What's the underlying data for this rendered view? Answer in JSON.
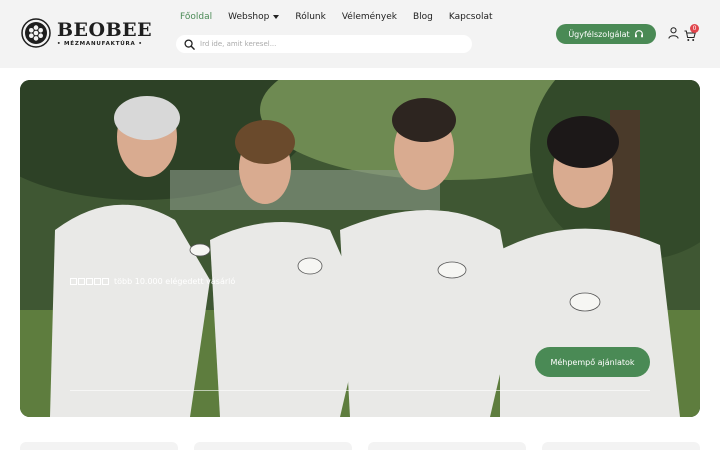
{
  "brand": {
    "name": "BEOBEE",
    "tagline": "• MÉZMANUFAKTÚRA •"
  },
  "nav": {
    "items": [
      {
        "label": "Főoldal",
        "active": true
      },
      {
        "label": "Webshop",
        "dropdown": true
      },
      {
        "label": "Rólunk"
      },
      {
        "label": "Vélemények"
      },
      {
        "label": "Blog"
      },
      {
        "label": "Kapcsolat"
      }
    ]
  },
  "search": {
    "placeholder": "Írd ide, amit keresel...",
    "value": ""
  },
  "header": {
    "support_label": "Ügyfélszolgálat",
    "cart_count": "0"
  },
  "hero": {
    "rating_text": "több 10.000 elégedett vásárló",
    "stars": 5,
    "button_label": "Méhpempő ajánlatok"
  },
  "colors": {
    "accent": "#4a8a55",
    "badge": "#e0454c",
    "header_bg": "#f3f3f3"
  },
  "icons": [
    "logo-honeycomb-icon",
    "search-icon",
    "headset-icon",
    "user-icon",
    "cart-icon",
    "chevron-down-icon"
  ]
}
